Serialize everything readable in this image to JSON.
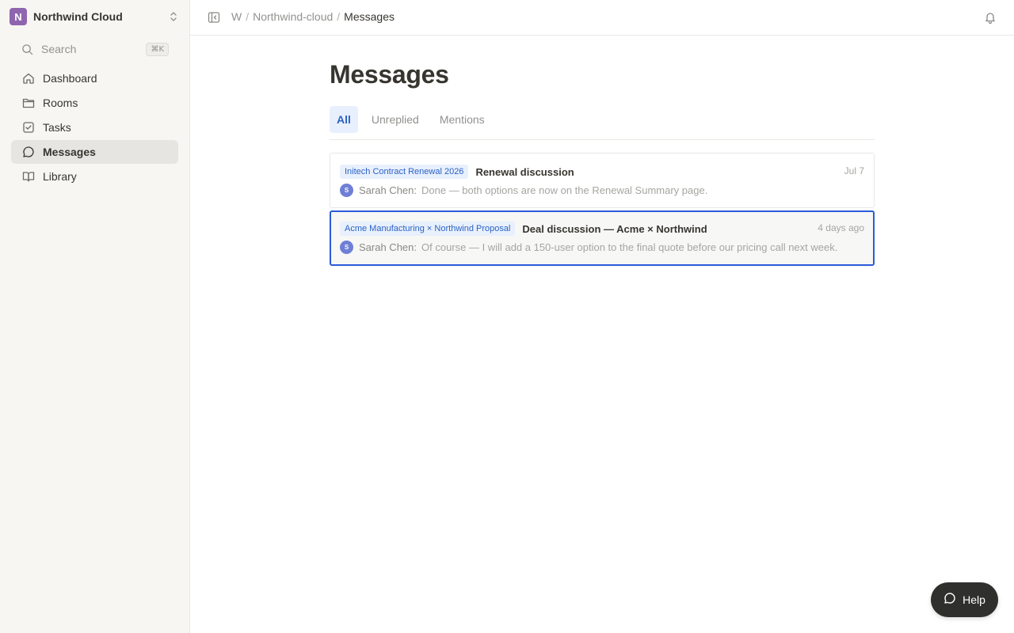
{
  "workspace": {
    "initial": "N",
    "name": "Northwind Cloud",
    "logo_color": "#9065b0"
  },
  "search": {
    "label": "Search",
    "shortcut": "⌘K"
  },
  "sidebar": {
    "items": [
      {
        "label": "Dashboard",
        "icon": "home-icon",
        "active": false
      },
      {
        "label": "Rooms",
        "icon": "folder-icon",
        "active": false
      },
      {
        "label": "Tasks",
        "icon": "checkbox-icon",
        "active": false
      },
      {
        "label": "Messages",
        "icon": "chat-bubble-icon",
        "active": true
      },
      {
        "label": "Library",
        "icon": "book-icon",
        "active": false
      }
    ]
  },
  "breadcrumb": [
    "W",
    "Northwind-cloud",
    "Messages"
  ],
  "page": {
    "title": "Messages"
  },
  "tabs": [
    {
      "label": "All",
      "active": true
    },
    {
      "label": "Unreplied",
      "active": false
    },
    {
      "label": "Mentions",
      "active": false
    }
  ],
  "messages": [
    {
      "tag": "Initech Contract Renewal 2026",
      "subject": "Renewal discussion",
      "time": "Jul 7",
      "avatar": "S",
      "sender": "Sarah Chen:",
      "preview": "Done — both options are now on the Renewal Summary page.",
      "selected": false
    },
    {
      "tag": "Acme Manufacturing × Northwind Proposal",
      "subject": "Deal discussion — Acme × Northwind",
      "time": "4 days ago",
      "avatar": "S",
      "sender": "Sarah Chen:",
      "preview": "Of course — I will add a 150-user option to the final quote before our pricing call next week.",
      "selected": true
    }
  ],
  "help": {
    "label": "Help"
  },
  "colors": {
    "accent": "#2a5bd7",
    "tag_text": "#2b62c4",
    "tag_bg": "#e8f0fd",
    "sidebar_bg": "#f7f6f3"
  }
}
